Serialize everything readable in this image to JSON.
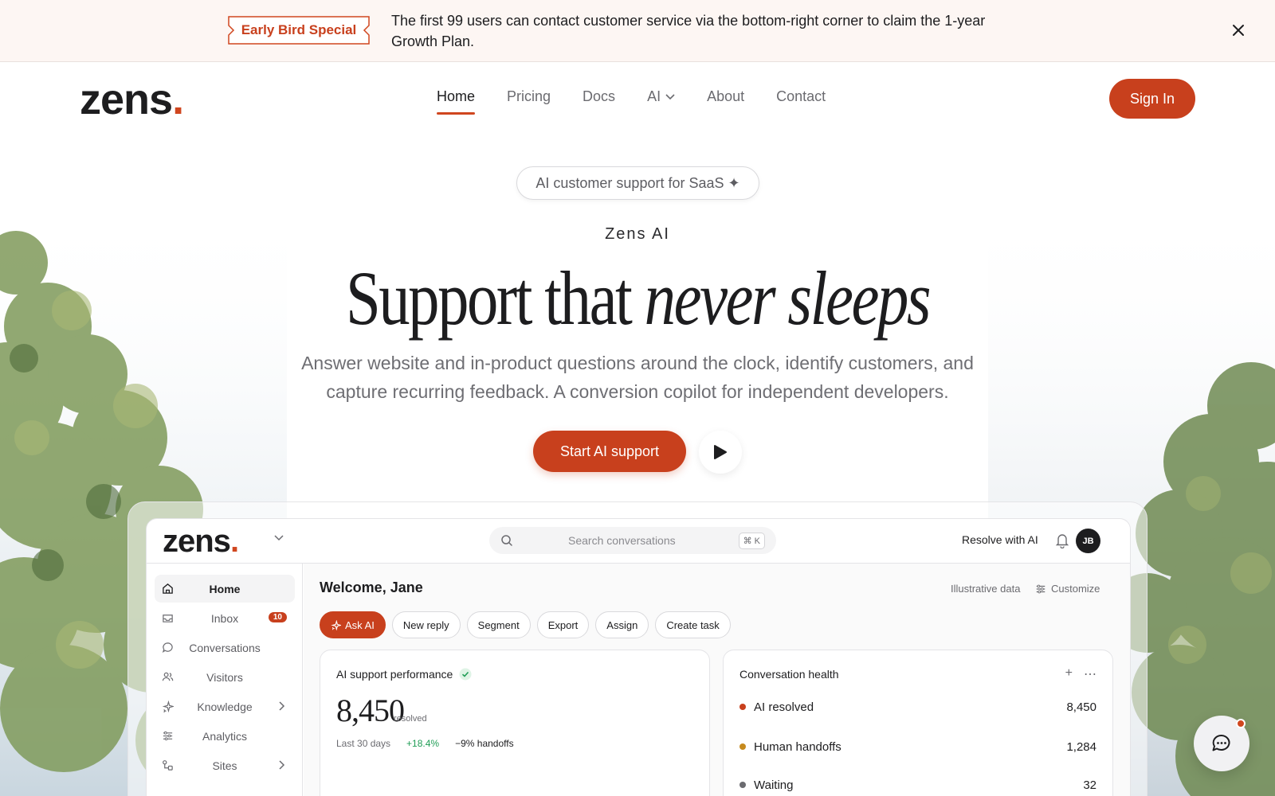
{
  "banner": {
    "tag": "Early Bird Special",
    "text": "The first 99 users can contact customer service via the bottom-right corner to claim the 1-year Growth Plan.",
    "close_icon": "close-icon"
  },
  "nav": {
    "logo": "zens",
    "logo_dot": ".",
    "links": [
      "Home",
      "Pricing",
      "Docs",
      "AI",
      "About",
      "Contact"
    ],
    "active": "Home",
    "signin": "Sign In"
  },
  "hero": {
    "pill": "AI customer support for SaaS ✦",
    "eyebrow": "Zens AI",
    "headline_plain": "Support that ",
    "headline_italic": "never sleeps",
    "sub": "Answer website and in-product questions around the clock, identify customers, and capture recurring feedback. A conversion copilot for independent developers.",
    "cta": "Start AI support"
  },
  "app": {
    "logo": "zens",
    "logo_dot": ".",
    "search_placeholder": "Search conversations",
    "search_kbd": "⌘ K",
    "resolve": "Resolve with AI",
    "avatar": "JB",
    "sidebar": [
      {
        "label": "Home",
        "icon": "home-icon"
      },
      {
        "label": "Inbox",
        "icon": "inbox-icon",
        "badge": "10"
      },
      {
        "label": "Conversations",
        "icon": "chat-icon"
      },
      {
        "label": "Visitors",
        "icon": "users-icon"
      },
      {
        "label": "Knowledge",
        "icon": "sparkle-icon"
      },
      {
        "label": "Analytics",
        "icon": "sliders-icon"
      },
      {
        "label": "Sites",
        "icon": "sites-icon"
      }
    ],
    "welcome": "Welcome, Jane",
    "illustrative": "Illustrative data",
    "customize": "Customize",
    "chips": [
      "Ask AI",
      "New reply",
      "Segment",
      "Export",
      "Assign",
      "Create task"
    ],
    "perf": {
      "title": "AI support performance",
      "value": "8,450",
      "unit": "resolved",
      "period": "Last 30 days",
      "change": "+18.4%",
      "handoffs": "−9% handoffs"
    },
    "health": {
      "title": "Conversation health",
      "rows": [
        {
          "label": "AI resolved",
          "value": "8,450",
          "color": "#c8401d"
        },
        {
          "label": "Human handoffs",
          "value": "1,284",
          "color": "#c68a1e"
        },
        {
          "label": "Waiting",
          "value": "32",
          "color": "#6b6b70"
        }
      ]
    }
  },
  "colors": {
    "accent": "#c8401d",
    "positive": "#1f9d55"
  }
}
